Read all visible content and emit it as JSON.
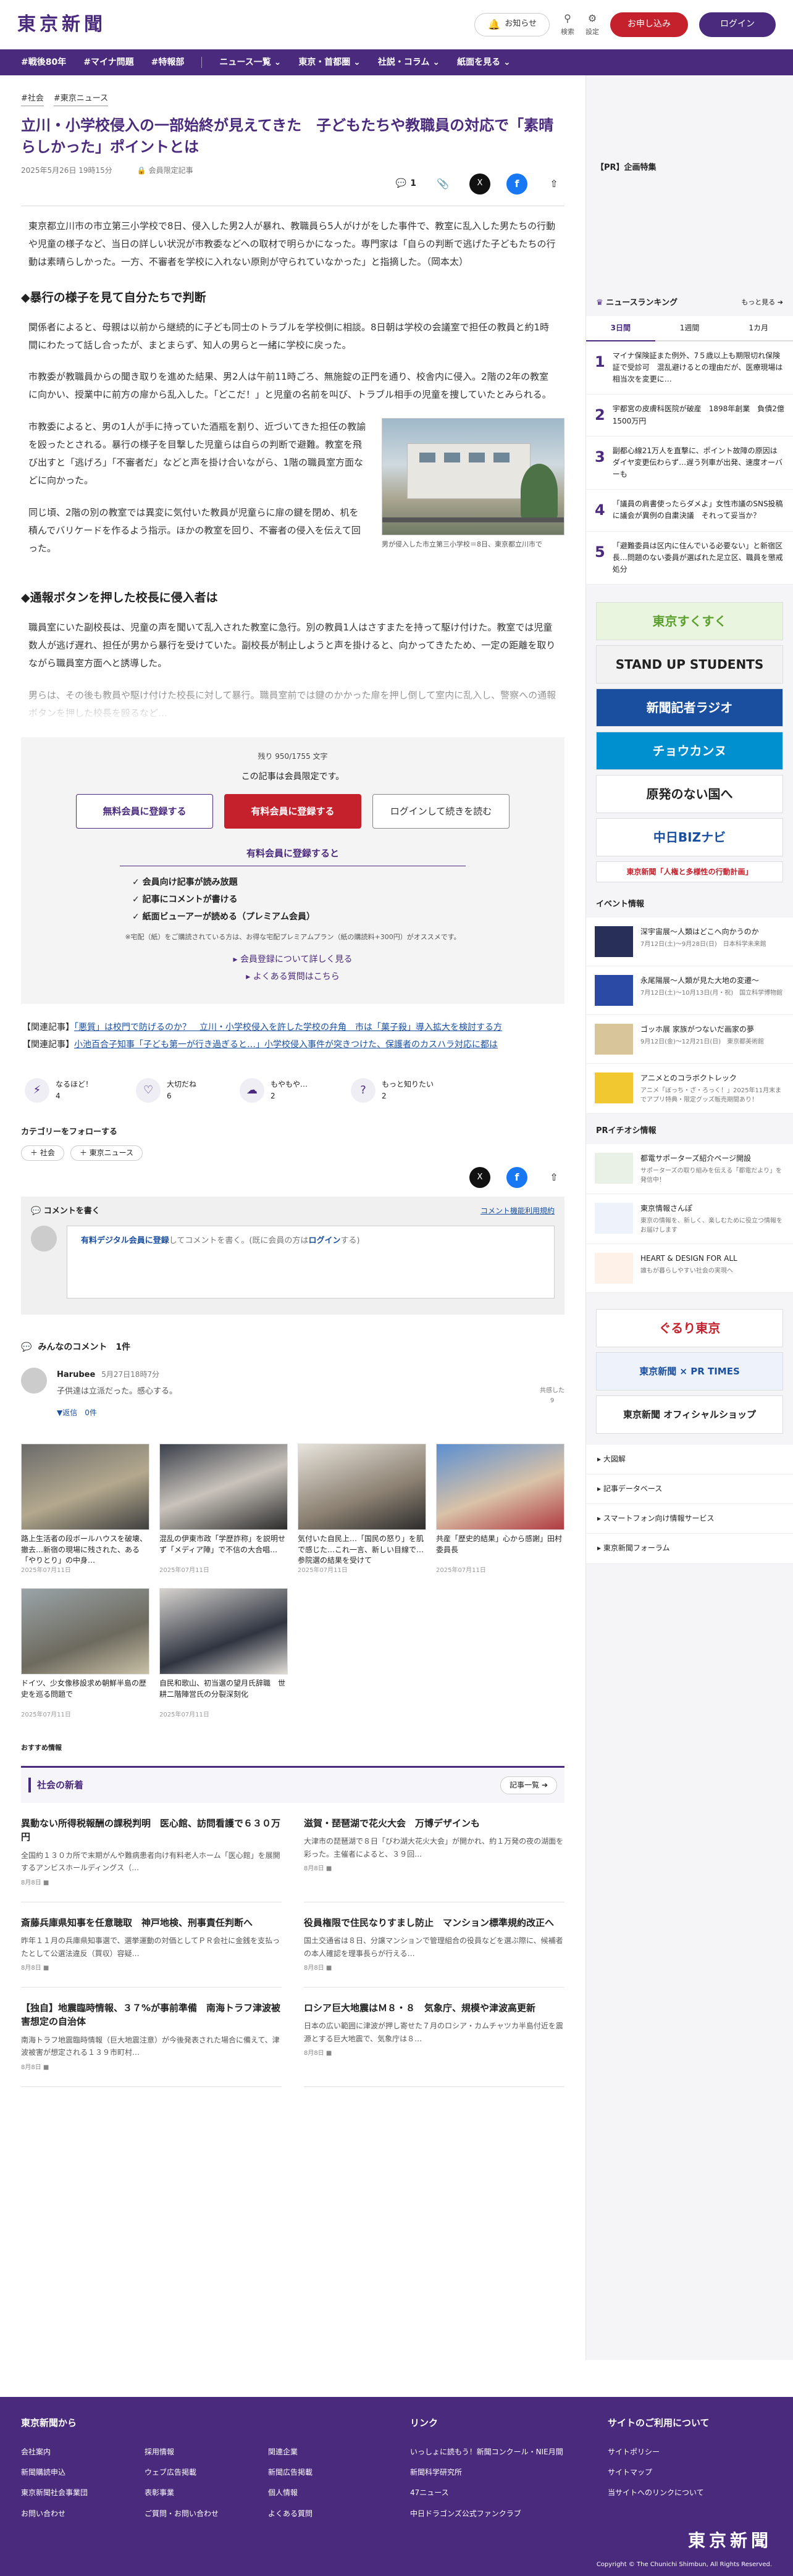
{
  "header": {
    "logo": "東京新聞",
    "notice": "お知らせ",
    "search": "検索",
    "settings": "設定",
    "signup": "お申し込み",
    "login": "ログイン"
  },
  "nav": [
    "#戦後80年",
    "#マイナ問題",
    "#特報部",
    "ニュース一覧 ⌄",
    "東京・首都圏 ⌄",
    "社説・コラム ⌄",
    "紙面を見る ⌄"
  ],
  "article": {
    "tags": [
      "#社会",
      "#東京ニュース"
    ],
    "title": "立川・小学校侵入の一部始終が見えてきた　子どもたちや教職員の対応で「素晴らしかった」ポイントとは",
    "date": "2025年5月26日 19時15分",
    "members_only": "会員限定記事",
    "comment_count": "1",
    "lead": "東京都立川市の市立第三小学校で8日、侵入した男2人が暴れ、教職員ら5人がけがをした事件で、教室に乱入した男たちの行動や児童の様子など、当日の詳しい状況が市教委などへの取材で明らかになった。専門家は「自らの判断で逃げた子どもたちの行動は素晴らしかった。一方、不審者を学校に入れない原則が守られていなかった」と指摘した。（岡本太）",
    "h2_1": "◆暴行の様子を見て自分たちで判断",
    "p1": "関係者によると、母親は以前から継続的に子ども同士のトラブルを学校側に相談。8日朝は学校の会議室で担任の教員と約1時間にわたって話し合ったが、まとまらず、知人の男らと一緒に学校に戻った。",
    "p2": "市教委が教職員からの聞き取りを進めた結果、男2人は午前11時ごろ、無施錠の正門を通り、校舎内に侵入。2階の2年の教室に向かい、授業中に前方の扉から乱入した。「どこだ！」と児童の名前を叫び、トラブル相手の児童を捜していたとみられる。",
    "p3": "市教委によると、男の1人が手に持っていた酒瓶を割り、近づいてきた担任の教諭を殴ったとされる。暴行の様子を目撃した児童らは自らの判断で避難。教室を飛び出すと「逃げろ」「不審者だ」などと声を掛け合いながら、1階の職員室方面などに向かった。",
    "p4": "同じ頃、2階の別の教室では異変に気付いた教員が児童らに扉の鍵を閉め、机を積んでバリケードを作るよう指示。ほかの教室を回り、不審者の侵入を伝えて回った。",
    "caption": "男が侵入した市立第三小学校＝8日、東京都立川市で",
    "h2_2": "◆通報ボタンを押した校長に侵入者は",
    "p5": "職員室にいた副校長は、児童の声を聞いて乱入された教室に急行。別の教員1人はさすまたを持って駆け付けた。教室では児童数人が逃げ遅れ、担任が男から暴行を受けていた。副校長が制止しようと声を掛けると、向かってきたため、一定の距離を取りながら職員室方面へと誘導した。",
    "p6": "男らは、その後も教員や駆け付けた校長に対して暴行。職員室前では鍵のかかった扉を押し倒して室内に乱入し、警察への通報ボタンを押した校長を殴るなど…"
  },
  "paywall": {
    "remaining": "残り 950/1755 文字",
    "limited": "この記事は会員限定です。",
    "free_btn": "無料会員に登録する",
    "paid_btn": "有料会員に登録する",
    "login_btn": "ログインして続きを読む",
    "benefit_title": "有料会員に登録すると",
    "benefits": [
      "会員向け記事が読み放題",
      "記事にコメントが書ける",
      "紙面ビューアーが読める（プレミアム会員）"
    ],
    "note": "※宅配（紙）をご購読されている方は、お得な宅配プレミアムプラン（紙の購読料+300円）がオススメです。",
    "link1": "会員登録について詳しく見る",
    "link2": "よくある質問はこちら"
  },
  "related": [
    {
      "label": "【関連記事】",
      "text": "「悪質」は校門で防げるのか？　立川・小学校侵入を許した学校の弁角　市は「菓子殺」導入拡大を検討する方"
    },
    {
      "label": "【関連記事】",
      "text": "小池百合子知事「子ども第一が行き過ぎると…」小学校侵入事件が突きつけた、保護者のカスハラ対応に都は"
    }
  ],
  "reactions": [
    {
      "label": "なるほど！",
      "count": "4"
    },
    {
      "label": "大切だね",
      "count": "6"
    },
    {
      "label": "もやもや…",
      "count": "2"
    },
    {
      "label": "もっと知りたい",
      "count": "2"
    }
  ],
  "follow": {
    "title": "カテゴリーをフォローする",
    "chips": [
      "＋ 社会",
      "＋ 東京ニュース"
    ]
  },
  "comment_box": {
    "title": "コメントを書く",
    "rule": "コメント機能利用規約",
    "prompt_pre": "有料デジタル会員に登録",
    "prompt_mid": "してコメントを書く。(既に会員の方は",
    "prompt_login": "ログイン",
    "prompt_end": "する)"
  },
  "comments_header": "みんなのコメント　1件",
  "comment": {
    "name": "Harubee",
    "date": "5月27日18時7分",
    "text": "子供達は立派だった。感心する。",
    "reply": "▼返信　0件",
    "more": "共感した\n9"
  },
  "photos": [
    {
      "title": "路上生活者の段ボールハウスを破壊、撤去…新宿の現場に残された、ある「やりとり」の中身…",
      "date": "2025年07月11日"
    },
    {
      "title": "混乱の伊東市政「学歴詐称」を説明せず「メディア陣」で不信の大合唱…",
      "date": "2025年07月11日"
    },
    {
      "title": "気付いた自民上…「国民の怒り」を肌で感じた…これ一言、新しい目線で…参院選の結果を受けて",
      "date": "2025年07月11日"
    },
    {
      "title": "共産「歴史的結果」心から感謝」田村委員長",
      "date": "2025年07月11日"
    },
    {
      "title": "ドイツ、少女像移設求め朝鮮半島の歴史を巡る問題で",
      "date": "2025年07月11日"
    },
    {
      "title": "自民和歌山、初当選の望月氏辞職　世耕二階陣営氏の分裂深刻化",
      "date": "2025年07月11日"
    }
  ],
  "osusume": "おすすめ情報",
  "social": {
    "title": "社会の新着",
    "more": "記事一覧 ➔"
  },
  "news": [
    {
      "h": "異動ない所得税報酬の課税判明　医心館、訪問看護で６３０万円",
      "b": "全国約１３０カ所で末期がんや難病患者向け有料老人ホーム「医心館」を展開するアンビスホールディングス（…",
      "d": "8月8日"
    },
    {
      "h": "滋賀・琵琶湖で花火大会　万博デザインも",
      "b": "大津市の琵琶湖で８日「びわ湖大花火大会」が開かれ、約１万発の夜の湖面を彩った。主催者によると、３９回…",
      "d": "8月8日"
    },
    {
      "h": "斎藤兵庫県知事を任意聴取　神戸地検、刑事責任判断へ",
      "b": "昨年１１月の兵庫県知事選で、選挙運動の対価としてＰＲ会社に金銭を支払ったとして公選法違反（買収）容疑…",
      "d": "8月8日"
    },
    {
      "h": "役員権限で住民なりすまし防止　マンション標準規約改正へ",
      "b": "国土交通省は８日、分譲マンションで管理組合の役員などを選ぶ際に、候補者の本人確認を理事長らが行える…",
      "d": "8月8日"
    },
    {
      "h": "【独自】地震臨時情報、３７%が事前準備　南海トラフ津波被害想定の自治体",
      "b": "南海トラフ地震臨時情報（巨大地震注意）が今後発表された場合に備えて、津波被害が想定される１３９市町村…",
      "d": "8月8日"
    },
    {
      "h": "ロシア巨大地震はＭ８・８　気象庁、規模や津波高更新",
      "b": "日本の広い範囲に津波が押し寄せた７月のロシア・カムチャツカ半島付近を震源とする巨大地震で、気象庁は８…",
      "d": "8月8日"
    }
  ],
  "side": {
    "pr": "【PR】企画特集",
    "ranking_title": "ニュースランキング",
    "ranking_more": "もっと見る ➔",
    "tabs": [
      "3日間",
      "1週間",
      "1カ月"
    ],
    "ranks": [
      {
        "n": "1",
        "t": "マイナ保険証また例外、7５歳以上も期限切れ保険証で受診可　混乱避けるとの理由だが、医療現場は相当次を変更に…"
      },
      {
        "n": "2",
        "t": "宇都宮の皮膚科医院が破産　1898年創業　負債2億1500万円"
      },
      {
        "n": "3",
        "t": "副都心線21万人を直撃に、ポイント故障の原因は　ダイヤ変更伝わらず…遅う列車が出発、速度オーバーも"
      },
      {
        "n": "4",
        "t": "「議員の肩書使ったらダメよ」女性市議のSNS投稿に議会が異例の自粛決議　それって妥当か？"
      },
      {
        "n": "5",
        "t": "「避難委員は区内に住んでいる必要ない」と新宿区長…問題のない委員が選ばれた足立区、職員を懲戒処分"
      }
    ],
    "banners": [
      {
        "t": "東京すくすく",
        "c": "#5aa02c"
      },
      {
        "t": "STAND UP STUDENTS",
        "c": "#222"
      },
      {
        "t": "新聞記者ラジオ",
        "c": "#1a4fa0"
      },
      {
        "t": "チョウカンヌ",
        "c": "#0090d0"
      },
      {
        "t": "原発のない国へ",
        "c": "#222"
      },
      {
        "t": "中日BIZナビ",
        "c": "#1a4fa0"
      },
      {
        "t": "東京新聞「人権と多様性の行動計画」",
        "c": "#c4212d"
      }
    ],
    "event_title": "イベント情報",
    "events": [
      {
        "t": "深宇宙展〜人類はどこへ向かうのか",
        "s": "7月12日(土)〜9月28日(日)　日本科学未来館",
        "c": "#28305a"
      },
      {
        "t": "永尾陽展〜人類が見た大地の変遷〜",
        "s": "7月12日(土)〜10月13日(月・祝)　国立科学博物館",
        "c": "#2b4aa6"
      },
      {
        "t": "ゴッホ展 家族がつないだ画家の夢",
        "s": "9月12日(金)〜12月21日(日)　東京都美術館",
        "c": "#d8c69a"
      },
      {
        "t": "アニメとのコラボクトレック",
        "s": "アニメ「ぼっち・ざ・ろっく！」2025年11月末までアプリ特典・限定グッズ販売期間あり！",
        "c": "#f2c830"
      }
    ],
    "pr_title": "PRイチオシ情報",
    "pr_items": [
      {
        "t": "都電サポーターズ紹介ページ開設",
        "s": "サポーターズの取り組みを伝える「都電だより」を発信中！",
        "c": "#e9f1e6"
      },
      {
        "t": "東京情報さんぽ",
        "s": "東京の情報を、新しく、楽しむために役立つ情報をお届けします",
        "c": "#eef3fb"
      },
      {
        "t": "HEART & DESIGN FOR ALL",
        "s": "誰もが暮らしやすい社会の実現へ",
        "c": "#fdf1e8"
      }
    ],
    "banners2": [
      {
        "t": "ぐるり東京",
        "c": "#c4212d"
      },
      {
        "t": "東京新聞 × PR TIMES",
        "c": "#1a4fa0"
      },
      {
        "t": "東京新聞 オフィシャルショップ",
        "c": "#222"
      }
    ],
    "links": [
      "大図解",
      "記事データベース",
      "スマートフォン向け情報サービス",
      "東京新聞フォーラム"
    ]
  },
  "footer": {
    "col1_title": "東京新聞から",
    "col1": [
      "会社案内",
      "採用情報",
      "関連企業",
      "新聞購読申込",
      "ウェブ広告掲載",
      "新聞広告掲載",
      "東京新聞社会事業団",
      "表彰事業",
      "個人情報",
      "お問い合わせ",
      "ご質問・お問い合わせ",
      "よくある質問"
    ],
    "col2_title": "リンク",
    "col2": [
      "いっしょに読もう！新聞コンクール・NIE月間",
      "",
      "新聞科学研究所",
      "",
      "47ニュース",
      "",
      "中日ドラゴンズ公式ファンクラブ",
      ""
    ],
    "col3_title": "サイトのご利用について",
    "col3": [
      "サイトポリシー",
      "サイトマップ",
      "当サイトへのリンクについて"
    ],
    "logo": "東京新聞",
    "copy": "Copyright © The Chunichi Shimbun, All Rights Reserved."
  }
}
